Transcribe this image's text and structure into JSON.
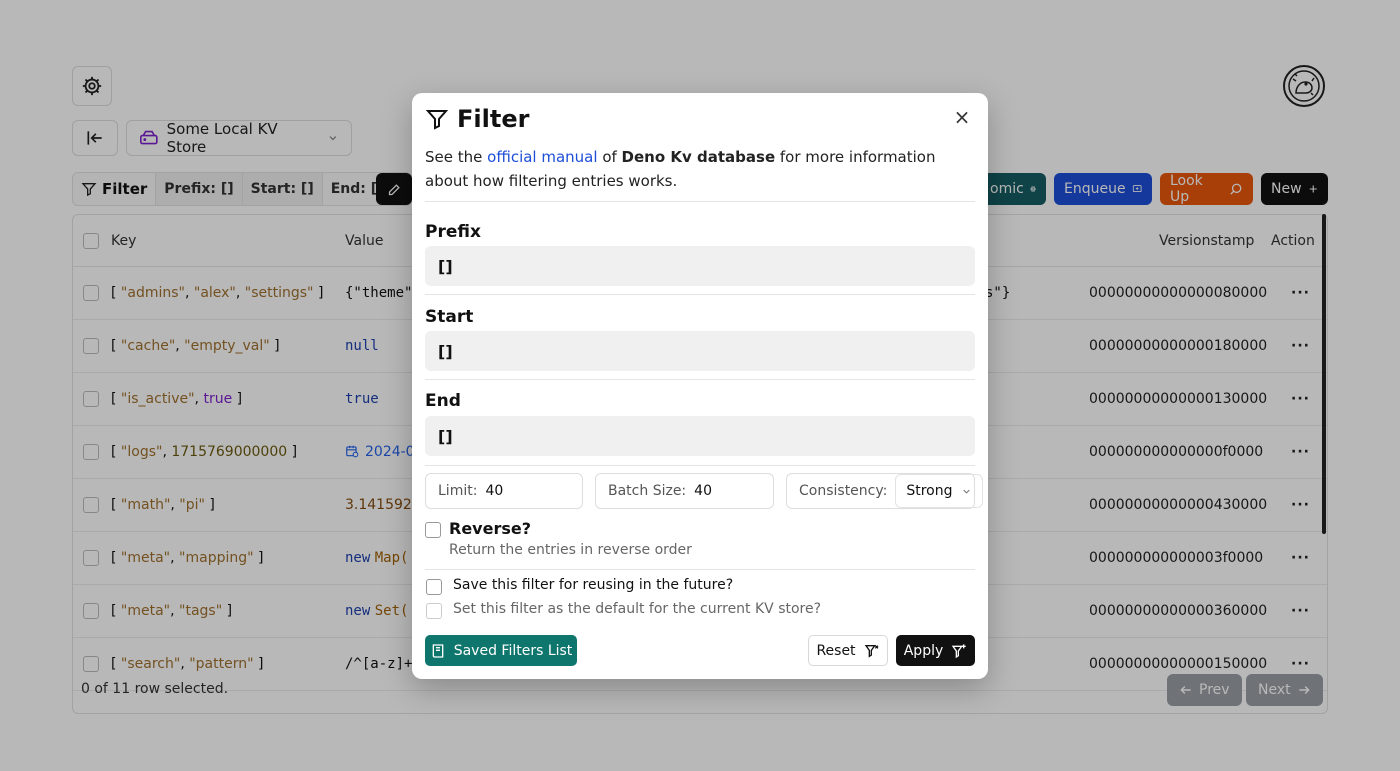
{
  "header": {
    "store_name": "Some Local KV Store"
  },
  "filter_bar": {
    "label": "Filter",
    "prefix": "Prefix: []",
    "start": "Start: []",
    "end": "End: []"
  },
  "actions": {
    "atomic": "omic",
    "enqueue": "Enqueue",
    "lookup": "Look Up",
    "new": "New"
  },
  "table": {
    "headers": {
      "key": "Key",
      "value": "Value",
      "versionstamp": "Versionstamp",
      "action": "Action"
    },
    "rows": [
      {
        "key": [
          [
            "str",
            "\"admins\""
          ],
          [
            "p",
            ", "
          ],
          [
            "str",
            "\"alex\""
          ],
          [
            "p",
            ", "
          ],
          [
            "str",
            "\"settings\""
          ]
        ],
        "value": "{\"theme\"",
        "value_tail": "s\"}",
        "versionstamp": "00000000000000080000"
      },
      {
        "key": [
          [
            "str",
            "\"cache\""
          ],
          [
            "p",
            ", "
          ],
          [
            "str",
            "\"empty_val\""
          ]
        ],
        "value": "null",
        "versionstamp": "00000000000000180000"
      },
      {
        "key": [
          [
            "str",
            "\"is_active\""
          ],
          [
            "p",
            ", "
          ],
          [
            "bool",
            "true"
          ]
        ],
        "value": "true",
        "versionstamp": "00000000000000130000"
      },
      {
        "key": [
          [
            "str",
            "\"logs\""
          ],
          [
            "p",
            ", "
          ],
          [
            "num",
            "1715769000000"
          ]
        ],
        "value": "2024-0",
        "versionstamp": "000000000000000f0000"
      },
      {
        "key": [
          [
            "str",
            "\"math\""
          ],
          [
            "p",
            ", "
          ],
          [
            "str",
            "\"pi\""
          ]
        ],
        "value": "3.1415926",
        "versionstamp": "00000000000000430000"
      },
      {
        "key": [
          [
            "str",
            "\"meta\""
          ],
          [
            "p",
            ", "
          ],
          [
            "str",
            "\"mapping\""
          ]
        ],
        "value_kw": "new",
        "value_cls": "Map(",
        "versionstamp": "000000000000003f0000"
      },
      {
        "key": [
          [
            "str",
            "\"meta\""
          ],
          [
            "p",
            ", "
          ],
          [
            "str",
            "\"tags\""
          ]
        ],
        "value_kw": "new",
        "value_cls": "Set(",
        "versionstamp": "00000000000000360000"
      },
      {
        "key": [
          [
            "str",
            "\"search\""
          ],
          [
            "p",
            ", "
          ],
          [
            "str",
            "\"pattern\""
          ]
        ],
        "value": "/^[a-z]+$/",
        "versionstamp": "00000000000000150000"
      }
    ],
    "action_dots": "···"
  },
  "footer": {
    "selected_text": "0 of 11 row selected.",
    "prev": "Prev",
    "next": "Next"
  },
  "modal": {
    "title": "Filter",
    "desc_pre": "See the ",
    "desc_link": "official manual",
    "desc_mid": " of ",
    "desc_bold": "Deno Kv database",
    "desc_post": " for more information about how filtering entries works.",
    "prefix_label": "Prefix",
    "prefix_value": "[]",
    "start_label": "Start",
    "start_value": "[]",
    "end_label": "End",
    "end_value": "[]",
    "limit_label": "Limit:",
    "limit_value": "40",
    "batch_label": "Batch Size:",
    "batch_value": "40",
    "consistency_label": "Consistency:",
    "consistency_value": "Strong",
    "reverse_label": "Reverse?",
    "reverse_hint": "Return the entries in reverse order",
    "save_label": "Save this filter for reusing in the future?",
    "default_label": "Set this filter as the default for the current KV store?",
    "saved_list": "Saved Filters List",
    "reset": "Reset",
    "apply": "Apply"
  }
}
